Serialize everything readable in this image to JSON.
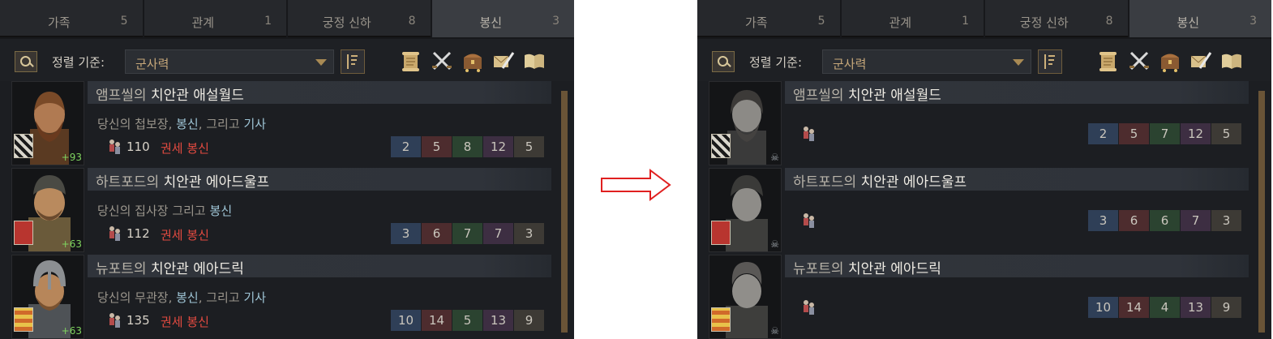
{
  "colors": {
    "panel_bg": "#1c1e22",
    "accent_gold": "#c7a87a",
    "status_red": "#e24a40",
    "highlight_blue": "#9fc5d6",
    "opinion_green": "#7fd35f",
    "arrow": "#e02020"
  },
  "left": {
    "tabs": [
      {
        "label": "가족",
        "count": "5"
      },
      {
        "label": "관계",
        "count": "1"
      },
      {
        "label": "궁정 신하",
        "count": "8"
      },
      {
        "label": "봉신",
        "count": "3"
      }
    ],
    "toolbar": {
      "sort_label": "정렬 기준:",
      "sort_value": "군사력",
      "icons": [
        "search-icon",
        "sort-direction-icon",
        "scroll-icon",
        "crossed-swords-icon",
        "chest-icon",
        "quill-letter-icon",
        "book-icon"
      ]
    },
    "vassals": [
      {
        "prefix": "앰프씰의 ",
        "name": "치안관 애설월드",
        "desc": [
          {
            "t": "당신의 첩보장, ",
            "hl": false
          },
          {
            "t": "봉신",
            "hl": true
          },
          {
            "t": ", 그리고 ",
            "hl": false
          },
          {
            "t": "기사",
            "hl": true
          }
        ],
        "opinion": "+93",
        "strength": "110",
        "status": "권세 봉신",
        "skills": [
          "2",
          "5",
          "8",
          "12",
          "5"
        ]
      },
      {
        "prefix": "하트포드의 ",
        "name": "치안관 에아드울프",
        "desc": [
          {
            "t": "당신의 집사장 그리고 ",
            "hl": false
          },
          {
            "t": "봉신",
            "hl": true
          }
        ],
        "opinion": "+63",
        "strength": "112",
        "status": "권세 봉신",
        "skills": [
          "3",
          "6",
          "7",
          "7",
          "3"
        ]
      },
      {
        "prefix": "뉴포트의 ",
        "name": "치안관 에아드릭",
        "desc": [
          {
            "t": "당신의 무관장, ",
            "hl": false
          },
          {
            "t": "봉신",
            "hl": true
          },
          {
            "t": ", 그리고 ",
            "hl": false
          },
          {
            "t": "기사",
            "hl": true
          }
        ],
        "opinion": "+63",
        "strength": "135",
        "status": "권세 봉신",
        "skills": [
          "10",
          "14",
          "5",
          "13",
          "9"
        ]
      }
    ]
  },
  "right": {
    "tabs": [
      {
        "label": "가족",
        "count": "5"
      },
      {
        "label": "관계",
        "count": "1"
      },
      {
        "label": "궁정 신하",
        "count": "8"
      },
      {
        "label": "봉신",
        "count": "3"
      }
    ],
    "toolbar": {
      "sort_label": "정렬 기준:",
      "sort_value": "군사력"
    },
    "vassals": [
      {
        "prefix": "앰프씰의 ",
        "name": "치안관 애설월드",
        "skills": [
          "2",
          "5",
          "7",
          "12",
          "5"
        ]
      },
      {
        "prefix": "하트포드의 ",
        "name": "치안관 에아드울프",
        "skills": [
          "3",
          "6",
          "6",
          "7",
          "3"
        ]
      },
      {
        "prefix": "뉴포트의 ",
        "name": "치안관 에아드릭",
        "skills": [
          "10",
          "14",
          "4",
          "13",
          "9"
        ]
      }
    ]
  }
}
